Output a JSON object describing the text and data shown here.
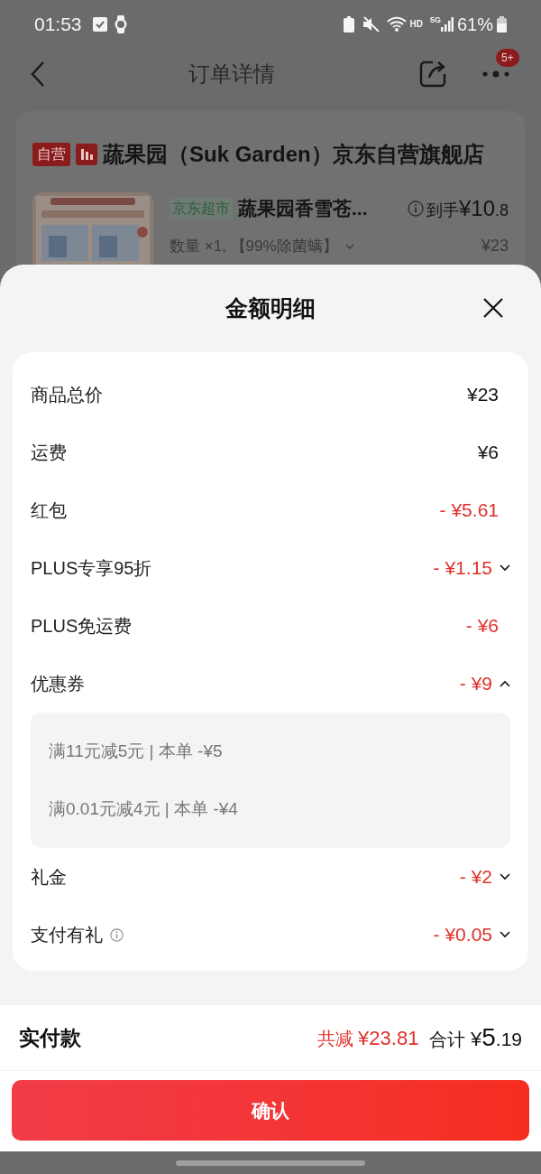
{
  "status_bar": {
    "time": "01:53",
    "network": "HD",
    "signal_type": "5G",
    "battery": "61%"
  },
  "nav": {
    "title": "订单详情",
    "badge": "5+"
  },
  "store": {
    "tag": "自营",
    "name": "蔬果园（Suk Garden）京东自营旗舰店"
  },
  "product": {
    "tag": "京东超市",
    "name": "蔬果园香雪苍...",
    "price_label": "到手",
    "price": "¥10.8",
    "quantity": "数量 ×1, 【99%除菌螨】",
    "original_price": "¥23"
  },
  "sheet": {
    "title": "金额明细",
    "rows": [
      {
        "label": "商品总价",
        "amount": "¥23",
        "discount": false
      },
      {
        "label": "运费",
        "amount": "¥6",
        "discount": false
      },
      {
        "label": "红包",
        "amount": "- ¥5.61",
        "discount": true
      },
      {
        "label": "PLUS专享95折",
        "amount": "- ¥1.15",
        "discount": true,
        "expanded": false
      },
      {
        "label": "PLUS免运费",
        "amount": "- ¥6",
        "discount": true
      },
      {
        "label": "优惠券",
        "amount": "- ¥9",
        "discount": true,
        "expanded": true,
        "details": [
          "满11元减5元 | 本单 -¥5",
          "满0.01元减4元 | 本单 -¥4"
        ]
      },
      {
        "label": "礼金",
        "amount": "- ¥2",
        "discount": true,
        "expanded": false
      },
      {
        "label": "支付有礼",
        "amount": "- ¥0.05",
        "discount": true,
        "expanded": false,
        "info": true
      }
    ]
  },
  "footer": {
    "label": "实付款",
    "saved_label": "共减",
    "saved": "¥23.81",
    "total_label": "合计",
    "total_main": "¥5",
    "total_fraction": ".19"
  },
  "confirm_button": "确认"
}
